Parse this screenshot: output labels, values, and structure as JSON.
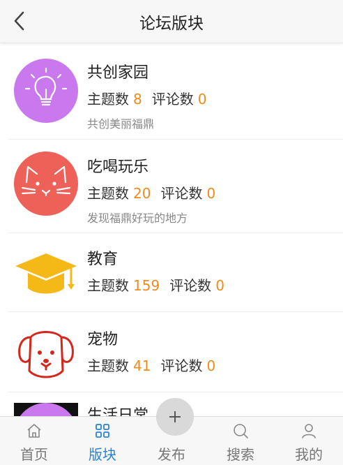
{
  "header": {
    "title": "论坛版块"
  },
  "forums": [
    {
      "name": "共创家园",
      "topics_label": "主题数",
      "topics": "8",
      "comments_label": "评论数",
      "comments": "0",
      "description": "共创美丽福鼎",
      "icon": "lightbulb-icon",
      "icon_bg": "#c978ee"
    },
    {
      "name": "吃喝玩乐",
      "topics_label": "主题数",
      "topics": "20",
      "comments_label": "评论数",
      "comments": "0",
      "description": "发现福鼎好玩的地方",
      "icon": "cat-icon",
      "icon_bg": "#ee6159"
    },
    {
      "name": "教育",
      "topics_label": "主题数",
      "topics": "159",
      "comments_label": "评论数",
      "comments": "0",
      "description": "",
      "icon": "graduation-cap-icon",
      "icon_bg": "#f5b917"
    },
    {
      "name": "宠物",
      "topics_label": "主题数",
      "topics": "41",
      "comments_label": "评论数",
      "comments": "0",
      "description": "",
      "icon": "dog-icon",
      "icon_bg": "#d3271b"
    },
    {
      "name": "生活日常",
      "icon": "lifestyle-icon",
      "icon_bg": "#c978ee"
    }
  ],
  "tabbar": {
    "items": [
      {
        "label": "首页",
        "icon": "home-icon"
      },
      {
        "label": "版块",
        "icon": "grid-icon",
        "active": true
      },
      {
        "label": "发布",
        "icon": "plus-icon"
      },
      {
        "label": "搜索",
        "icon": "search-icon"
      },
      {
        "label": "我的",
        "icon": "user-icon"
      }
    ]
  },
  "colors": {
    "accent": "#2a83d4",
    "count": "#ef8a1c"
  }
}
